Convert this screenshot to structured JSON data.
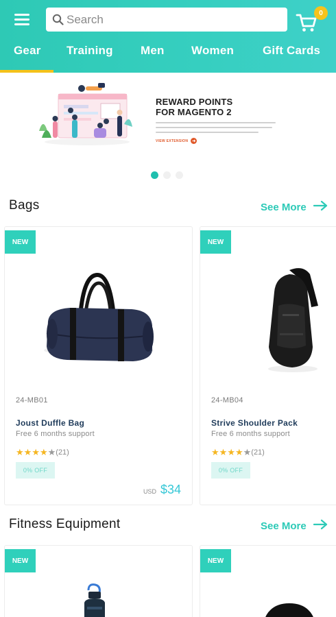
{
  "header": {
    "search_placeholder": "Search",
    "cart_count": "0",
    "nav": [
      "Gear",
      "Training",
      "Men",
      "Women",
      "Gift Cards"
    ]
  },
  "banner": {
    "title_line1": "REWARD POINTS",
    "title_line2": "FOR MAGENTO 2",
    "link": "VIEW EXTENSION"
  },
  "sections": {
    "bags": {
      "title": "Bags",
      "see_more": "See More",
      "products": [
        {
          "badge": "NEW",
          "sku": "24-MB01",
          "name": "Joust Duffle Bag",
          "subtitle": "Free 6 months support",
          "stars": 4,
          "reviews": "(21)",
          "discount": "0% OFF",
          "currency": "USD",
          "price": "$34"
        },
        {
          "badge": "NEW",
          "sku": "24-MB04",
          "name": "Strive Shoulder Pack",
          "subtitle": "Free 6 months support",
          "stars": 4,
          "reviews": "(21)",
          "discount": "0% OFF"
        }
      ]
    },
    "fitness": {
      "title": "Fitness Equipment",
      "see_more": "See More",
      "products": [
        {
          "badge": "NEW"
        },
        {
          "badge": "NEW"
        }
      ]
    }
  },
  "colors": {
    "brand": "#2ec9b5",
    "accent": "#f5c21a",
    "price": "#35c7d6",
    "banner_link": "#e0592a"
  },
  "icons": [
    "menu-icon",
    "search-icon",
    "cart-icon",
    "arrow-right-icon",
    "star-icon"
  ]
}
